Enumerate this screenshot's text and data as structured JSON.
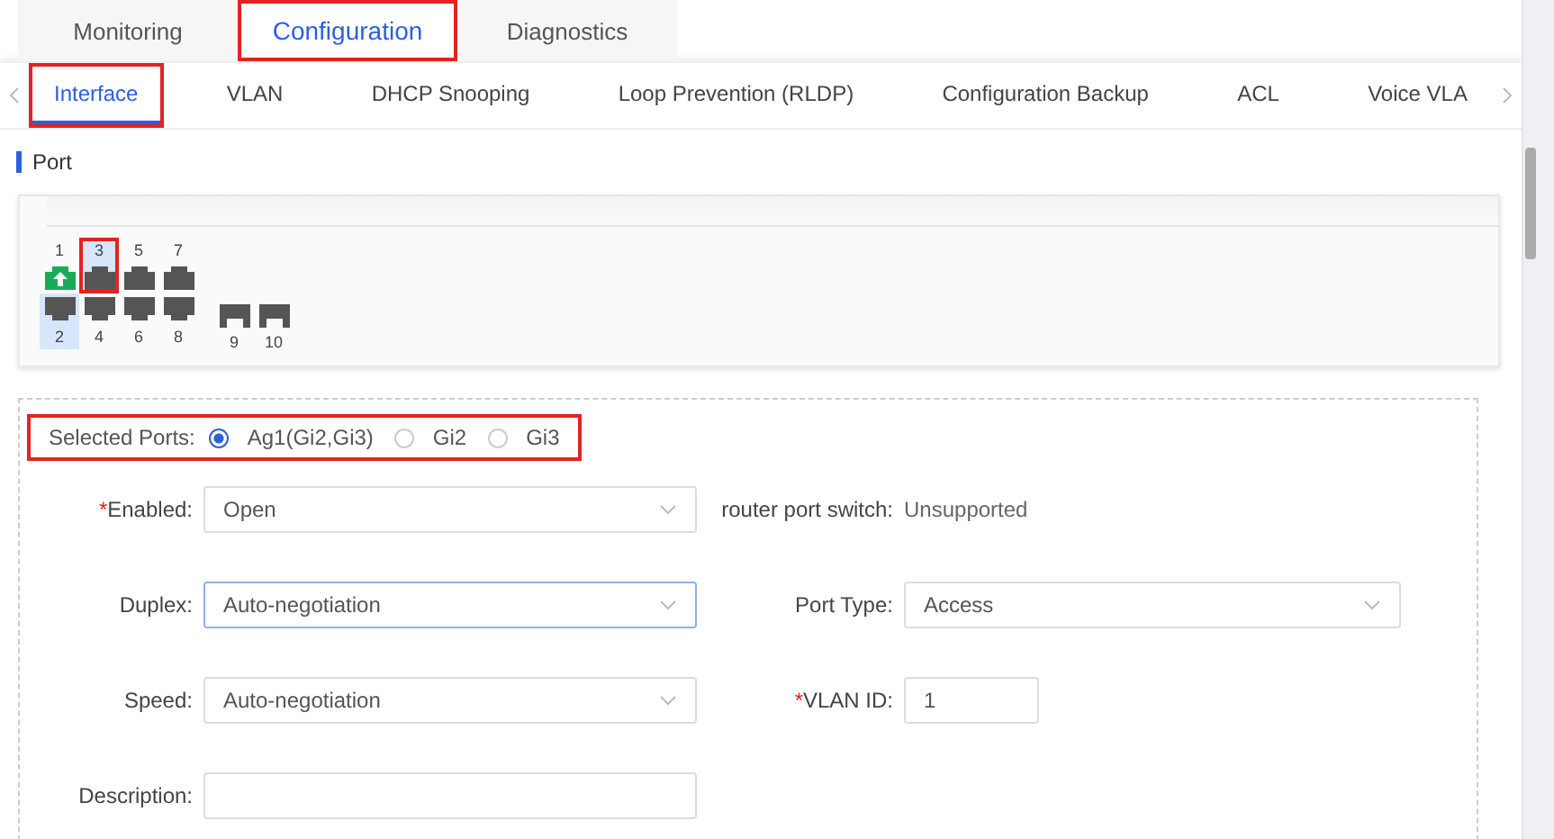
{
  "main_tabs": [
    {
      "label": "Monitoring",
      "selected": false,
      "annotated": false
    },
    {
      "label": "Configuration",
      "selected": true,
      "annotated": true
    },
    {
      "label": "Diagnostics",
      "selected": false,
      "annotated": false
    }
  ],
  "sub_tabs": [
    {
      "label": "Interface",
      "selected": true,
      "annotated": true
    },
    {
      "label": "VLAN",
      "selected": false,
      "annotated": false
    },
    {
      "label": "DHCP Snooping",
      "selected": false,
      "annotated": false
    },
    {
      "label": "Loop Prevention (RLDP)",
      "selected": false,
      "annotated": false
    },
    {
      "label": "Configuration Backup",
      "selected": false,
      "annotated": false
    },
    {
      "label": "ACL",
      "selected": false,
      "annotated": false
    },
    {
      "label": "Voice VLA",
      "selected": false,
      "annotated": false
    }
  ],
  "section_title": "Port",
  "port_columns": [
    {
      "top": {
        "label": "1",
        "kind": "rj45",
        "link_up": true,
        "selected": false,
        "annotated": false
      },
      "bottom": {
        "label": "2",
        "kind": "rj45",
        "link_up": false,
        "selected": true,
        "annotated": false
      }
    },
    {
      "top": {
        "label": "3",
        "kind": "rj45",
        "link_up": false,
        "selected": true,
        "annotated": true
      },
      "bottom": {
        "label": "4",
        "kind": "rj45",
        "link_up": false,
        "selected": false,
        "annotated": false
      }
    },
    {
      "top": {
        "label": "5",
        "kind": "rj45",
        "link_up": false,
        "selected": false,
        "annotated": false
      },
      "bottom": {
        "label": "6",
        "kind": "rj45",
        "link_up": false,
        "selected": false,
        "annotated": false
      }
    },
    {
      "top": {
        "label": "7",
        "kind": "rj45",
        "link_up": false,
        "selected": false,
        "annotated": false
      },
      "bottom": {
        "label": "8",
        "kind": "rj45",
        "link_up": false,
        "selected": false,
        "annotated": false
      }
    },
    {
      "bottom": {
        "label": "9",
        "kind": "sfp",
        "link_up": false,
        "selected": false,
        "annotated": false
      }
    },
    {
      "bottom": {
        "label": "10",
        "kind": "sfp",
        "link_up": false,
        "selected": false,
        "annotated": false
      }
    }
  ],
  "selected_ports": {
    "label": "Selected Ports:",
    "annotated": true,
    "options": [
      {
        "label": "Ag1(Gi2,Gi3)",
        "selected": true
      },
      {
        "label": "Gi2",
        "selected": false
      },
      {
        "label": "Gi3",
        "selected": false
      }
    ]
  },
  "form_rows": [
    {
      "left": {
        "required_mark": "*",
        "label": "Enabled:",
        "kind": "select",
        "value": "Open",
        "focused": false
      },
      "right": {
        "label": "router port switch:",
        "kind": "info",
        "value": "Unsupported"
      }
    },
    {
      "left": {
        "label": "Duplex:",
        "kind": "select",
        "value": "Auto-negotiation",
        "focused": true
      },
      "right": {
        "label": "Port Type:",
        "kind": "select",
        "value": "Access",
        "focused": false
      }
    },
    {
      "left": {
        "label": "Speed:",
        "kind": "select",
        "value": "Auto-negotiation",
        "focused": false
      },
      "right": {
        "required_mark": "*",
        "label": "VLAN ID:",
        "kind": "input",
        "value": "1",
        "focused": false
      }
    },
    {
      "left": {
        "label": "Description:",
        "kind": "input",
        "focused": false
      }
    }
  ]
}
